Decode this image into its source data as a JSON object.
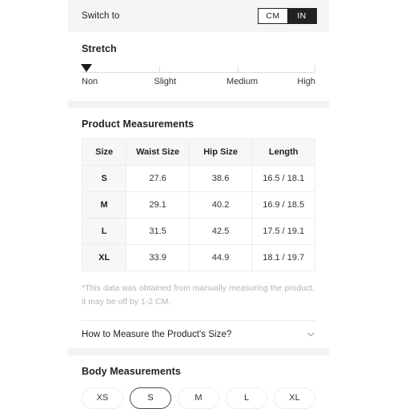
{
  "switch": {
    "label": "Switch to",
    "units": [
      {
        "label": "CM",
        "active": false
      },
      {
        "label": "IN",
        "active": true
      }
    ]
  },
  "stretch": {
    "title": "Stretch",
    "levels": [
      "Non",
      "Slight",
      "Medium",
      "High"
    ],
    "selected": "Non",
    "marker_position_percent": 0
  },
  "product_measurements": {
    "title": "Product Measurements",
    "columns": [
      "Size",
      "Waist Size",
      "Hip Size",
      "Length"
    ],
    "rows": [
      {
        "size": "S",
        "waist": "27.6",
        "hip": "38.6",
        "length": "16.5 / 18.1"
      },
      {
        "size": "M",
        "waist": "29.1",
        "hip": "40.2",
        "length": "16.9 / 18.5"
      },
      {
        "size": "L",
        "waist": "31.5",
        "hip": "42.5",
        "length": "17.5 / 19.1"
      },
      {
        "size": "XL",
        "waist": "33.9",
        "hip": "44.9",
        "length": "18.1 / 19.7"
      }
    ],
    "footnote": "*This data was obtained from manually measuring the product, it may be off by 1-2 CM."
  },
  "accordion": {
    "title": "How to Measure the Product's Size?",
    "icon": "chevron-down-icon",
    "expanded": false
  },
  "body_measurements": {
    "title": "Body Measurements",
    "sizes": [
      {
        "label": "XS",
        "selected": false
      },
      {
        "label": "S",
        "selected": true
      },
      {
        "label": "M",
        "selected": false
      },
      {
        "label": "L",
        "selected": false
      },
      {
        "label": "XL",
        "selected": false
      }
    ]
  },
  "colors": {
    "accent_dark": "#222222",
    "band_grey": "#f2f2f2",
    "header_grey": "#f7f7f7",
    "muted_text": "#b5b5b5",
    "border": "#ececec"
  }
}
